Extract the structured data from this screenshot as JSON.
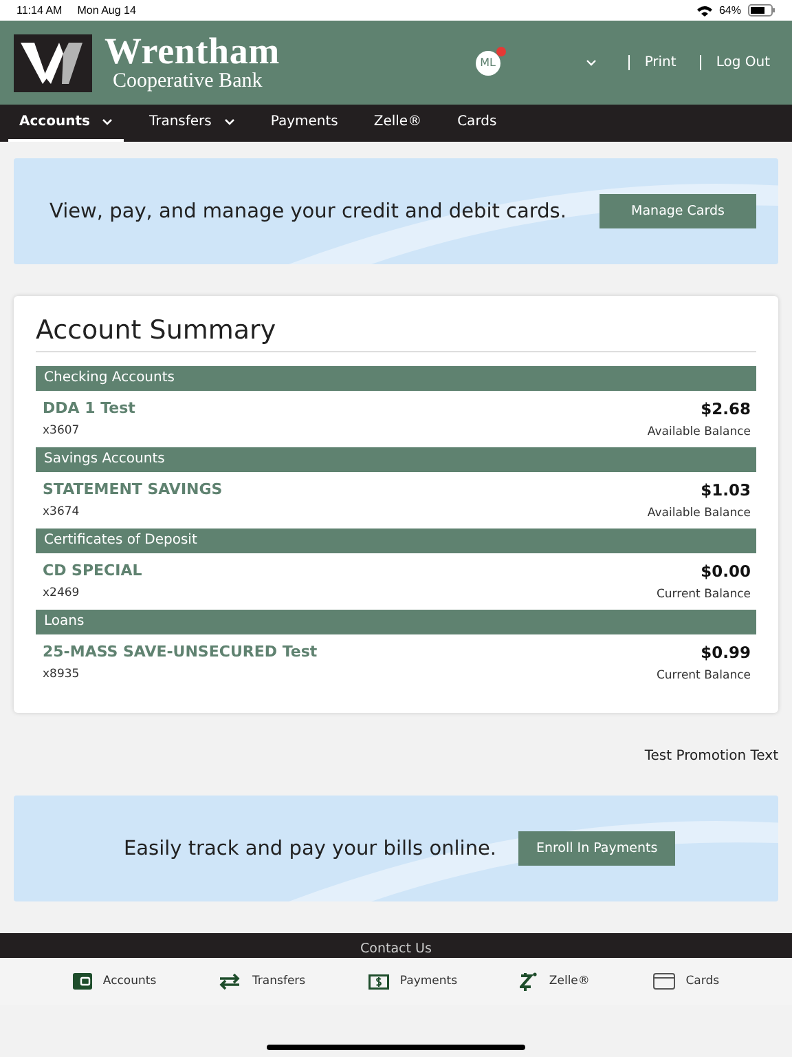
{
  "status_bar": {
    "time": "11:14 AM",
    "date": "Mon Aug 14",
    "battery": "64%"
  },
  "header": {
    "bank_name": "Wrentham",
    "bank_subtitle": "Cooperative Bank",
    "avatar": "ML",
    "notification": true,
    "links": [
      "Print",
      "Log Out"
    ]
  },
  "nav": [
    {
      "label": "Accounts",
      "selected": true,
      "has_menu": true
    },
    {
      "label": "Transfers",
      "selected": false,
      "has_menu": true
    },
    {
      "label": "Payments",
      "selected": false,
      "has_menu": false
    },
    {
      "label": "Zelle®",
      "selected": false,
      "has_menu": false
    },
    {
      "label": "Cards",
      "selected": false,
      "has_menu": false
    }
  ],
  "cards_banner": {
    "text": "View, pay, and manage your credit and debit cards.",
    "button": "Manage Cards"
  },
  "summary": {
    "title": "Account Summary",
    "groups": [
      {
        "heading": "Checking Accounts",
        "accounts": [
          {
            "name": "DDA 1 Test",
            "number": "x3607",
            "balance": "$2.68",
            "balance_label": "Available Balance"
          }
        ]
      },
      {
        "heading": "Savings Accounts",
        "accounts": [
          {
            "name": "STATEMENT SAVINGS",
            "number": "x3674",
            "balance": "$1.03",
            "balance_label": "Available Balance"
          }
        ]
      },
      {
        "heading": "Certificates of Deposit",
        "accounts": [
          {
            "name": "CD SPECIAL",
            "number": "x2469",
            "balance": "$0.00",
            "balance_label": "Current Balance"
          }
        ]
      },
      {
        "heading": "Loans",
        "accounts": [
          {
            "name": "25-MASS SAVE-UNSECURED Test",
            "number": "x8935",
            "balance": "$0.99",
            "balance_label": "Current Balance"
          }
        ]
      }
    ]
  },
  "promotion": "Test Promotion Text",
  "payments_banner": {
    "text": "Easily track and pay your bills online.",
    "button": "Enroll In Payments"
  },
  "footer": {
    "link": "Contact Us"
  },
  "tab_bar": [
    {
      "kind": "wallet",
      "label": "Accounts"
    },
    {
      "kind": "arrows",
      "label": "Transfers"
    },
    {
      "kind": "dollar",
      "label": "Payments"
    },
    {
      "kind": "zelle",
      "label": "Zelle®"
    },
    {
      "kind": "card",
      "label": "Cards"
    }
  ]
}
